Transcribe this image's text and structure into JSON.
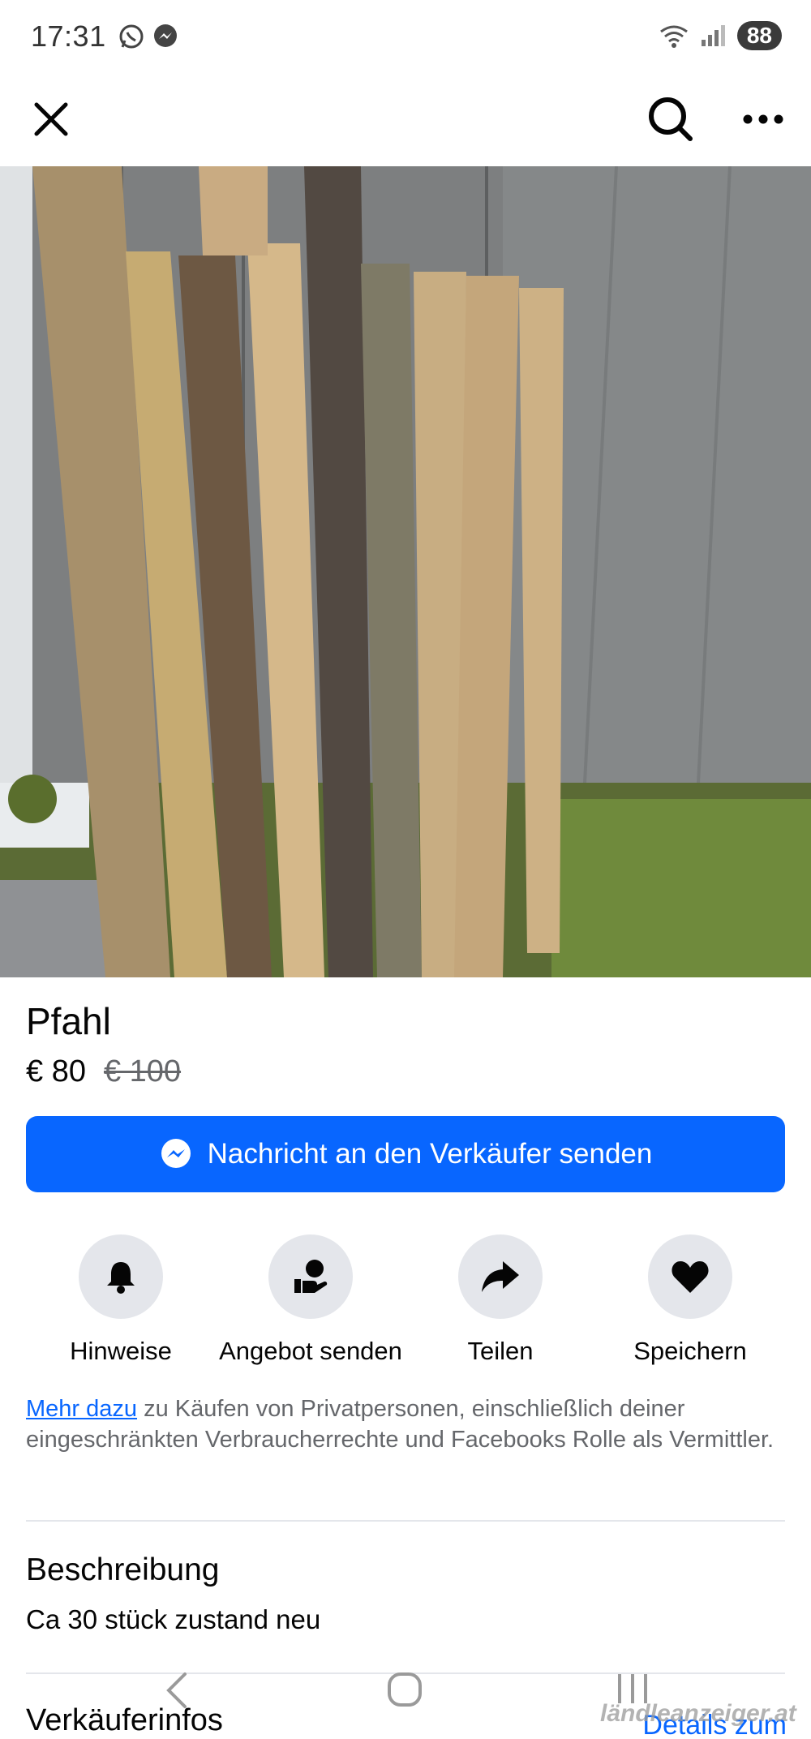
{
  "status_bar": {
    "time": "17:31",
    "battery": "88",
    "app_icons": [
      "whatsapp-icon",
      "messenger-icon"
    ]
  },
  "nav": {
    "icons": [
      "close-icon",
      "search-icon",
      "more-icon"
    ]
  },
  "listing": {
    "title": "Pfahl",
    "price": "€ 80",
    "original_price": "€ 100"
  },
  "message_button": {
    "label": "Nachricht an den Verkäufer senden"
  },
  "actions": [
    {
      "label": "Hinweise",
      "icon": "bell-icon"
    },
    {
      "label": "Angebot senden",
      "icon": "offer-icon"
    },
    {
      "label": "Teilen",
      "icon": "share-icon"
    },
    {
      "label": "Speichern",
      "icon": "heart-icon"
    }
  ],
  "disclaimer": {
    "link": "Mehr dazu",
    "text": " zu Käufen von Privatpersonen, einschließlich deiner eingeschränkten Verbraucherrechte und Facebooks Rolle als Vermittler."
  },
  "description": {
    "title": "Beschreibung",
    "text": "Ca 30 stück zustand neu"
  },
  "seller": {
    "title": "Verkäuferinfos",
    "details_link": "Details zum"
  },
  "watermark": "ländleanzeiger.at",
  "colors": {
    "accent": "#0866ff",
    "secondary_text": "#65676b",
    "circle_bg": "#e4e6eb"
  }
}
